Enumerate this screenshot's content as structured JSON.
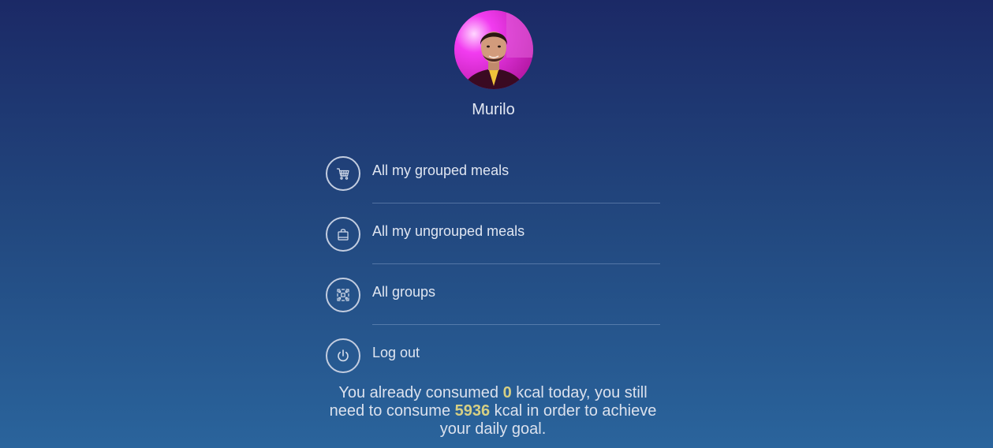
{
  "profile": {
    "name": "Murilo"
  },
  "menu": {
    "items": [
      {
        "label": "All my grouped meals",
        "icon": "shopping-cart-icon"
      },
      {
        "label": "All my ungrouped meals",
        "icon": "shopping-bag-icon"
      },
      {
        "label": "All groups",
        "icon": "grid-icon"
      },
      {
        "label": "Log out",
        "icon": "power-icon"
      }
    ]
  },
  "summary": {
    "part1": "You already consumed ",
    "consumed": "0",
    "part2": " kcal today, you still need to consume ",
    "remaining": "5936",
    "part3": " kcal in order to achieve your daily goal."
  },
  "colors": {
    "background_top": "#1b2966",
    "background_bottom": "#2a649c",
    "highlight": "#d6cf83"
  }
}
